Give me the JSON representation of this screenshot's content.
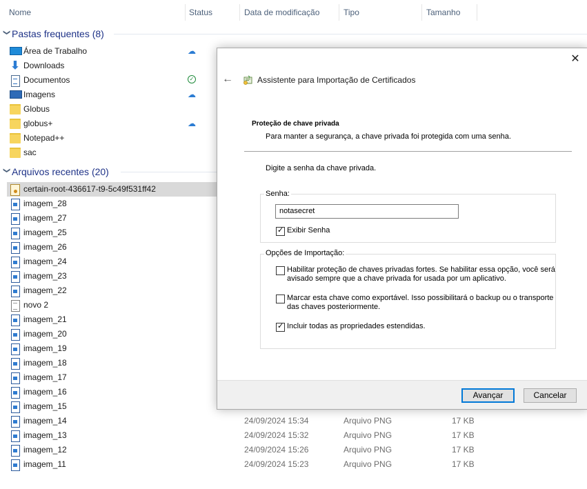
{
  "columns": [
    "Nome",
    "Status",
    "Data de modificação",
    "Tipo",
    "Tamanho"
  ],
  "groups": {
    "frequent": {
      "title": "Pastas frequentes (8)",
      "chevron": "chevron-down-icon"
    },
    "recent": {
      "title": "Arquivos recentes (20)",
      "chevron": "chevron-down-icon"
    }
  },
  "frequent_items": [
    {
      "name": "Área de Trabalho",
      "icon": "desktop-icon",
      "status": "cloud"
    },
    {
      "name": "Downloads",
      "icon": "download-icon",
      "status": ""
    },
    {
      "name": "Documentos",
      "icon": "document-icon",
      "status": "ok"
    },
    {
      "name": "Imagens",
      "icon": "pictures-icon",
      "status": "cloud"
    },
    {
      "name": "Globus",
      "icon": "folder-icon",
      "status": ""
    },
    {
      "name": "globus+",
      "icon": "folder-icon",
      "status": "cloud"
    },
    {
      "name": "Notepad++",
      "icon": "folder-icon",
      "status": ""
    },
    {
      "name": "sac",
      "icon": "folder-icon",
      "status": ""
    }
  ],
  "recent_items": [
    {
      "name": "certain-root-436617-t9-5c49f531ff42",
      "icon": "certificate-icon",
      "selected": true
    },
    {
      "name": "imagem_28",
      "icon": "image-file-icon"
    },
    {
      "name": "imagem_27",
      "icon": "image-file-icon"
    },
    {
      "name": "imagem_25",
      "icon": "image-file-icon"
    },
    {
      "name": "imagem_26",
      "icon": "image-file-icon"
    },
    {
      "name": "imagem_24",
      "icon": "image-file-icon"
    },
    {
      "name": "imagem_23",
      "icon": "image-file-icon"
    },
    {
      "name": "imagem_22",
      "icon": "image-file-icon"
    },
    {
      "name": "novo 2",
      "icon": "text-file-icon"
    },
    {
      "name": "imagem_21",
      "icon": "image-file-icon"
    },
    {
      "name": "imagem_20",
      "icon": "image-file-icon"
    },
    {
      "name": "imagem_19",
      "icon": "image-file-icon"
    },
    {
      "name": "imagem_18",
      "icon": "image-file-icon"
    },
    {
      "name": "imagem_17",
      "icon": "image-file-icon"
    },
    {
      "name": "imagem_16",
      "icon": "image-file-icon"
    },
    {
      "name": "imagem_15",
      "icon": "image-file-icon"
    },
    {
      "name": "imagem_14",
      "icon": "image-file-icon"
    },
    {
      "name": "imagem_13",
      "icon": "image-file-icon"
    },
    {
      "name": "imagem_12",
      "icon": "image-file-icon"
    },
    {
      "name": "imagem_11",
      "icon": "image-file-icon"
    }
  ],
  "details": [
    {
      "date": "24/09/2024 15:34",
      "type": "Arquivo PNG",
      "size": "17 KB"
    },
    {
      "date": "24/09/2024 15:32",
      "type": "Arquivo PNG",
      "size": "17 KB"
    },
    {
      "date": "24/09/2024 15:26",
      "type": "Arquivo PNG",
      "size": "17 KB"
    },
    {
      "date": "24/09/2024 15:23",
      "type": "Arquivo PNG",
      "size": "17 KB"
    }
  ],
  "dialog": {
    "title": "Assistente para Importação de Certificados",
    "section_title": "Proteção de chave privada",
    "section_desc": "Para manter a segurança, a chave privada foi protegida com uma senha.",
    "intro": "Digite a senha da chave privada.",
    "password_legend": "Senha:",
    "password_value": "notasecret",
    "show_password_label": "Exibir Senha",
    "show_password_checked": true,
    "options_legend": "Opções de Importação:",
    "options": [
      {
        "label": "Habilitar proteção de chaves privadas fortes. Se habilitar essa opção, você será avisado sempre que a chave privada for usada por um aplicativo.",
        "checked": false
      },
      {
        "label": "Marcar esta chave como exportável. Isso possibilitará o backup ou o transporte das chaves posteriormente.",
        "checked": false
      },
      {
        "label": "Incluir todas as propriedades estendidas.",
        "checked": true
      }
    ],
    "next_button": "Avançar",
    "cancel_button": "Cancelar"
  }
}
